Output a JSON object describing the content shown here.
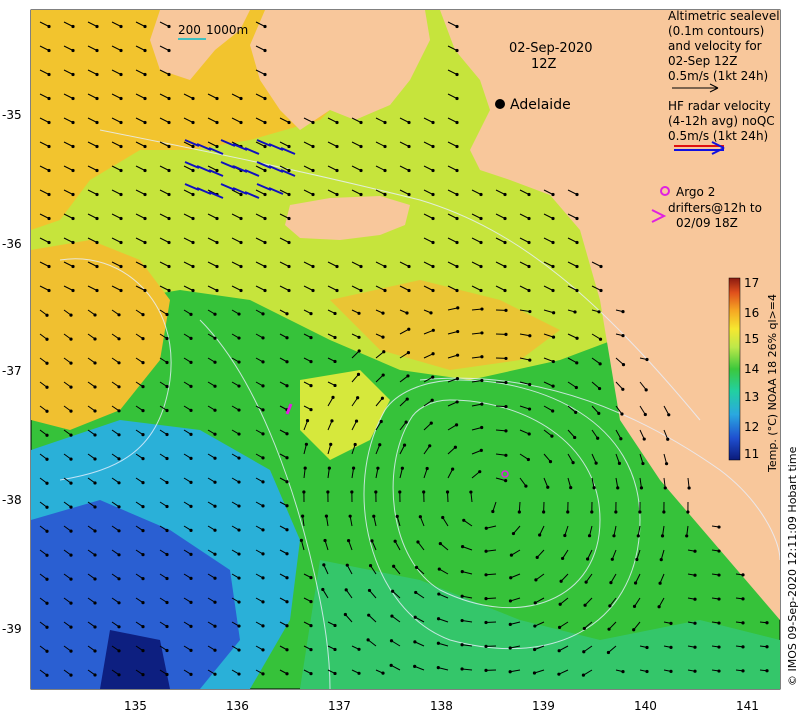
{
  "map": {
    "date_label": "02-Sep-2020",
    "time_label": "12Z",
    "city": "Adelaide",
    "scale_bar": {
      "label_a": "200",
      "label_b": "1000m"
    },
    "x_ticks": [
      "135",
      "136",
      "137",
      "138",
      "139",
      "140",
      "141"
    ],
    "y_ticks": [
      "-35",
      "-36",
      "-37",
      "-38",
      "-39"
    ],
    "legend_altimetric": [
      "Altimetric sealevel",
      "(0.1m contours)",
      "and velocity for",
      "02-Sep 12Z",
      "0.5m/s (1kt 24h)"
    ],
    "legend_radar": [
      "HF radar velocity",
      "(4-12h avg) noQC",
      "0.5m/s (1kt 24h)"
    ],
    "legend_argo": [
      "Argo 2",
      "drifters@12h to",
      "02/09 18Z"
    ],
    "colorbar": {
      "ticks": [
        "17",
        "16",
        "15",
        "14",
        "13",
        "12",
        "11"
      ],
      "label": "Temp. (°C) NOAA 18 26% ql>=4",
      "colors": [
        "#0b1a7a",
        "#1f4fd0",
        "#2aa8e0",
        "#22d0a0",
        "#3cc83c",
        "#bde84a",
        "#f6e830",
        "#f6a823",
        "#e0501c",
        "#8a1a10"
      ]
    },
    "credit": "© IMOS 09-Sep-2020 12:11:09 Hobart time",
    "land_color": "#f8c79b",
    "ocean_colors": {
      "cold": "#2a5fd2",
      "cool": "#31b4d6",
      "mid": "#2fc03a",
      "warm": "#c8e640",
      "hot": "#f5c632"
    }
  }
}
